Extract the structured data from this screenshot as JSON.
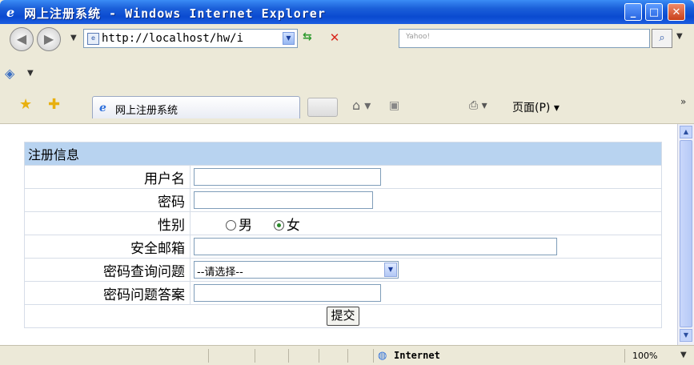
{
  "window": {
    "title": "网上注册系统 - Windows Internet Explorer",
    "icon": "ie-icon",
    "minimize": "_",
    "maximize": "□",
    "close": "✕"
  },
  "address_bar": {
    "url": "http://localhost/hw/i",
    "search_placeholder": "Yahoo!",
    "search_icon": "magnifier",
    "back_icon": "◀",
    "forward_icon": "▶"
  },
  "tab": {
    "label": "网上注册系统"
  },
  "toolbar": {
    "page_menu": "页面(P) ▾"
  },
  "form": {
    "header": "注册信息",
    "fields": {
      "username_label": "用户名",
      "password_label": "密码",
      "gender_label": "性别",
      "gender_male": "男",
      "gender_female": "女",
      "gender_selected": "女",
      "email_label": "安全邮箱",
      "question_label": "密码查询问题",
      "question_selected": "--请选择--",
      "answer_label": "密码问题答案"
    },
    "submit_label": "提交"
  },
  "status_bar": {
    "zone": "Internet",
    "zoom": "100%"
  },
  "colors": {
    "title_bar": "#0a4ad0",
    "form_header_bg": "#b8d3f0"
  }
}
